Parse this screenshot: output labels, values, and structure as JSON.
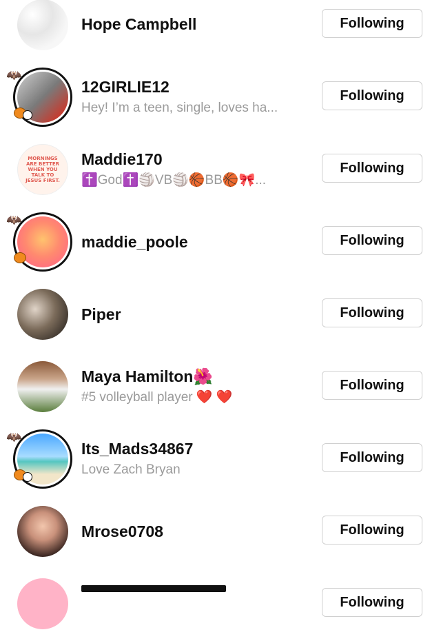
{
  "follow_label": "Following",
  "users": [
    {
      "username": "Hope Campbell",
      "bio": "",
      "avatar": "floral-pattern"
    },
    {
      "username": "12GIRLIE12",
      "bio": "Hey! I’m a teen, single, loves ha...",
      "avatar": "girl-selfie",
      "story_ring": true
    },
    {
      "username": "Maddie170",
      "bio": "✝️God✝️🏐VB🏐🏀BB🏀🎀...",
      "avatar": "text-quote",
      "avatar_quote": "MORNINGS ARE BETTER WHEN YOU TALK TO JESUS FIRST."
    },
    {
      "username": "maddie_poole",
      "bio": "",
      "avatar": "pink-orange-gradient",
      "story_ring": true
    },
    {
      "username": "Piper",
      "bio": "",
      "avatar": "two-cats"
    },
    {
      "username": "Maya Hamilton🌺",
      "bio": "#5 volleyball player ❤️ ❤️",
      "avatar": "girl-standing"
    },
    {
      "username": "Its_Mads34867",
      "bio": "Love Zach Bryan",
      "avatar": "beach",
      "story_ring": true
    },
    {
      "username": "Mrose0708",
      "bio": "",
      "avatar": "girl-glasses"
    }
  ],
  "partial_row_visible": true,
  "colors": {
    "text": "#111111",
    "subtext": "#9a9a9a",
    "button_border": "#d0d0d0"
  }
}
